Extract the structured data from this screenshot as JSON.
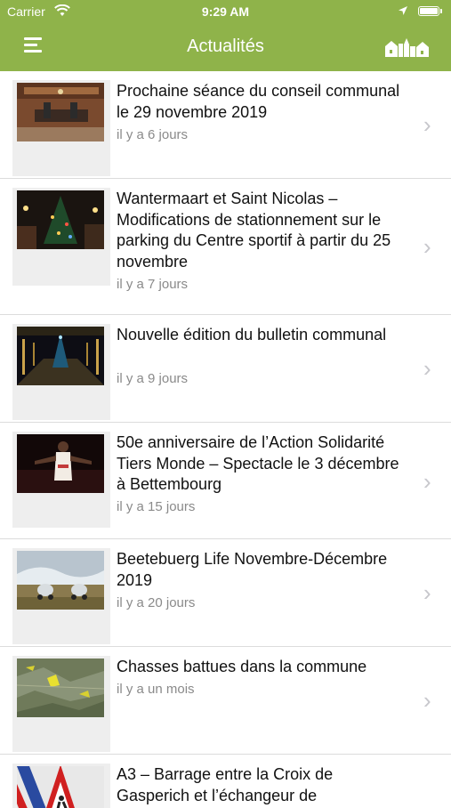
{
  "status_bar": {
    "carrier": "Carrier",
    "time": "9:29 AM"
  },
  "nav": {
    "title": "Actualités",
    "menu_icon": "hamburger-icon",
    "right_icon": "town-skyline-icon"
  },
  "colors": {
    "accent": "#8fb34a",
    "chevron": "#c7c7cc",
    "date_text": "#8a8a8a"
  },
  "news": [
    {
      "title": "Prochaine séance du conseil communal le 29 novembre 2019",
      "date": "il y a 6 jours"
    },
    {
      "title": "Wantermaart et Saint Nicolas – Modifications de stationnement sur le parking du Centre sportif à partir du 25 novembre",
      "date": "il y a 7 jours"
    },
    {
      "title": "Nouvelle édition du bulletin communal",
      "date": "il y a 9 jours"
    },
    {
      "title": "50e anniversaire de l’Action Solidarité Tiers Monde – Spectacle le 3 décembre à Bettembourg",
      "date": "il y a 15 jours"
    },
    {
      "title": "Beetebuerg Life Novembre-Décembre 2019",
      "date": "il y a 20 jours"
    },
    {
      "title": "Chasses battues dans la commune",
      "date": "il y a un mois"
    },
    {
      "title": "A3 – Barrage entre la Croix de Gasperich et l’échangeur de",
      "date": ""
    }
  ]
}
